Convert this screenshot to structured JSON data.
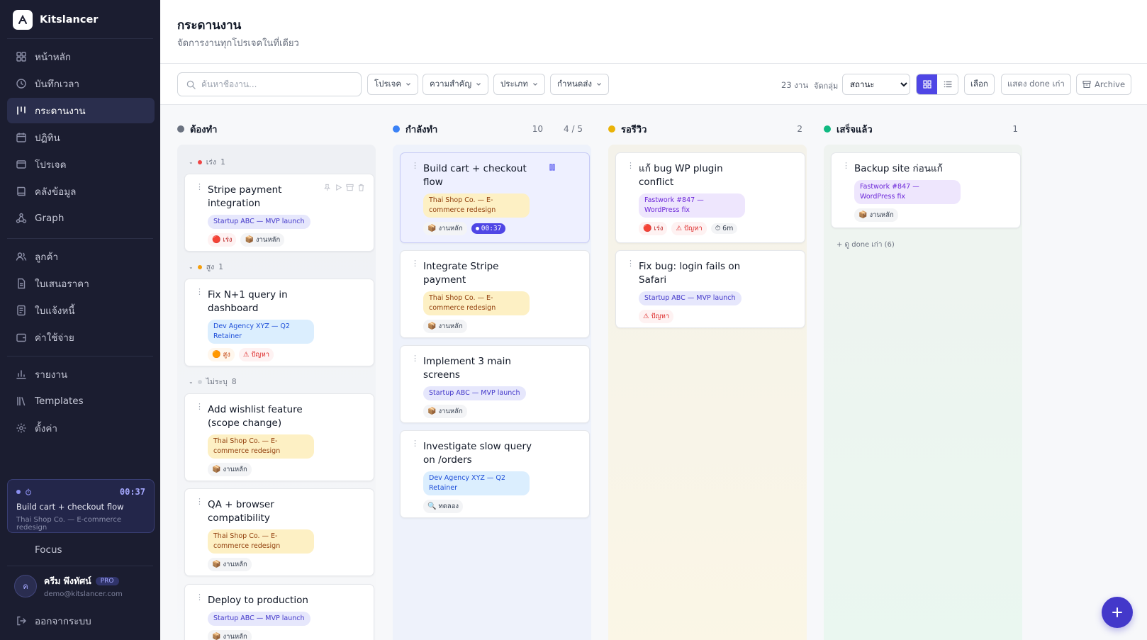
{
  "brand": {
    "name": "Kitslancer"
  },
  "sidebar": {
    "items": [
      {
        "label": "หน้าหลัก",
        "icon": "grid-icon"
      },
      {
        "label": "บันทึกเวลา",
        "icon": "clock-icon"
      },
      {
        "label": "กระดานงาน",
        "icon": "kanban-icon",
        "active": true
      },
      {
        "label": "ปฏิทิน",
        "icon": "calendar-icon"
      },
      {
        "label": "โปรเจค",
        "icon": "folder-icon"
      },
      {
        "label": "คลังข้อมูล",
        "icon": "book-icon"
      },
      {
        "label": "Graph",
        "icon": "graph-icon"
      },
      {
        "label": "ลูกค้า",
        "icon": "users-icon"
      },
      {
        "label": "ใบเสนอราคา",
        "icon": "document-icon"
      },
      {
        "label": "ใบแจ้งหนี้",
        "icon": "invoice-icon"
      },
      {
        "label": "ค่าใช้จ่าย",
        "icon": "wallet-icon"
      },
      {
        "label": "รายงาน",
        "icon": "bar-chart-icon"
      },
      {
        "label": "Templates",
        "icon": "library-icon"
      },
      {
        "label": "ตั้งค่า",
        "icon": "gear-icon"
      }
    ],
    "timer": {
      "time": "00:37",
      "title": "Build cart + checkout flow",
      "project": "Thai Shop Co. — E-commerce redesign"
    },
    "focus": "Focus",
    "user": {
      "initial": "ค",
      "name": "ครีม พึงทัศน์",
      "badge": "PRO",
      "email": "demo@kitslancer.com"
    },
    "logout": "ออกจากระบบ"
  },
  "header": {
    "title": "กระดานงาน",
    "subtitle": "จัดการงานทุกโปรเจคในที่เดียว"
  },
  "toolbar": {
    "search_placeholder": "ค้นหาชื่องาน...",
    "filters": [
      "โปรเจค",
      "ความสำคัญ",
      "ประเภท",
      "กำหนดส่ง"
    ],
    "count": "23 งาน",
    "group_label": "จัดกลุ่ม",
    "group_value": "สถานะ",
    "select_btn": "เลือก",
    "show_done": "แสดง done เก่า",
    "archive": "Archive"
  },
  "columns": {
    "todo": {
      "name": "ต้องทำ",
      "count": "10",
      "color": "#6b7280",
      "groups": [
        {
          "label": "เร่ง",
          "count": "1",
          "color": "#ef4444"
        },
        {
          "label": "สูง",
          "count": "1",
          "color": "#f59e0b"
        },
        {
          "label": "ไม่ระบุ",
          "count": "8",
          "color": "#d1d5db"
        }
      ],
      "cards": [
        {
          "title": "Stripe payment integration",
          "project": "Startup ABC — MVP launch",
          "tags": [
            "เร่ง",
            "งานหลัก"
          ]
        },
        {
          "title": "Fix N+1 query in dashboard",
          "project": "Dev Agency XYZ — Q2 Retainer",
          "tags": [
            "สูง",
            "ปัญหา"
          ]
        },
        {
          "title": "Add wishlist feature (scope change)",
          "project": "Thai Shop Co. — E-commerce redesign",
          "tags": [
            "งานหลัก"
          ]
        },
        {
          "title": "QA + browser compatibility",
          "project": "Thai Shop Co. — E-commerce redesign",
          "tags": [
            "งานหลัก"
          ]
        },
        {
          "title": "Deploy to production",
          "project": "Startup ABC — MVP launch",
          "tags": [
            "งานหลัก"
          ]
        }
      ]
    },
    "doing": {
      "name": "กำลังทำ",
      "count": "4 / 5",
      "color": "#3b82f6",
      "cards": [
        {
          "title": "Build cart + checkout flow",
          "project": "Thai Shop Co. — E-commerce redesign",
          "tags": [
            "งานหลัก",
            "00:37"
          ]
        },
        {
          "title": "Integrate Stripe payment",
          "project": "Thai Shop Co. — E-commerce redesign",
          "tags": [
            "งานหลัก"
          ]
        },
        {
          "title": "Implement 3 main screens",
          "project": "Startup ABC — MVP launch",
          "tags": [
            "งานหลัก"
          ]
        },
        {
          "title": "Investigate slow query on /orders",
          "project": "Dev Agency XYZ — Q2 Retainer",
          "tags": [
            "ทดลอง"
          ]
        }
      ]
    },
    "review": {
      "name": "รอรีวิว",
      "count": "2",
      "color": "#eab308",
      "cards": [
        {
          "title": "แก้ bug WP plugin conflict",
          "project": "Fastwork #847 — WordPress fix",
          "tags": [
            "เร่ง",
            "ปัญหา",
            "6m"
          ]
        },
        {
          "title": "Fix bug: login fails on Safari",
          "project": "Startup ABC — MVP launch",
          "tags": [
            "ปัญหา"
          ]
        }
      ]
    },
    "done": {
      "name": "เสร็จแล้ว",
      "count": "1",
      "color": "#10b981",
      "cards": [
        {
          "title": "Backup site ก่อนแก้",
          "project": "Fastwork #847 — WordPress fix",
          "tags": [
            "งานหลัก"
          ]
        }
      ],
      "more": "+ ดู done เก่า (6)"
    }
  }
}
